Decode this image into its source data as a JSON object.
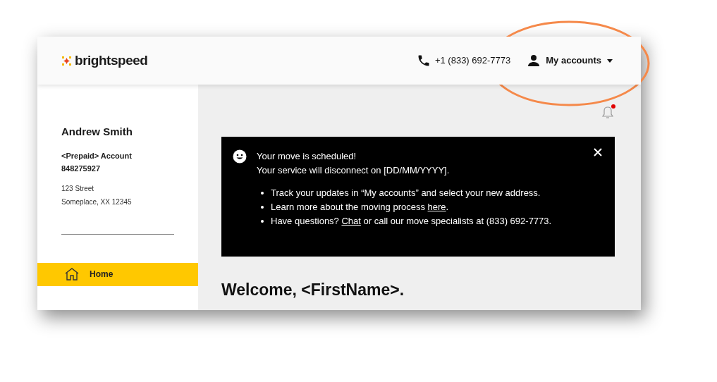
{
  "header": {
    "logo": "brightspeed",
    "phone": "+1 (833) 692-7773",
    "account_menu": {
      "label": "My accounts"
    }
  },
  "sidebar": {
    "name": "Andrew Smith",
    "account_type": "<Prepaid> Account",
    "account_number": "848275927",
    "address_lines": [
      "123 Street",
      "Someplace, XX 12345"
    ],
    "nav": [
      {
        "label": "Home",
        "selected": true
      }
    ]
  },
  "notifications": {
    "unread": true
  },
  "notice": {
    "title": "Your move is scheduled!",
    "subtitle": "Your service will disconnect on [DD/MM/YYYY].",
    "bullets": [
      [
        {
          "kind": "plain",
          "text": "Track your updates in “My accounts” and select your new address."
        }
      ],
      [
        {
          "kind": "plain",
          "text": "Learn more about the moving process "
        },
        {
          "kind": "link",
          "text": "here"
        },
        {
          "kind": "plain",
          "text": "."
        }
      ],
      [
        {
          "kind": "plain",
          "text": "Have questions? "
        },
        {
          "kind": "link",
          "text": "Chat"
        },
        {
          "kind": "plain",
          "text": " or call our move specialists at (833) 692-7773."
        }
      ]
    ]
  },
  "welcome": "Welcome, <FirstName>."
}
